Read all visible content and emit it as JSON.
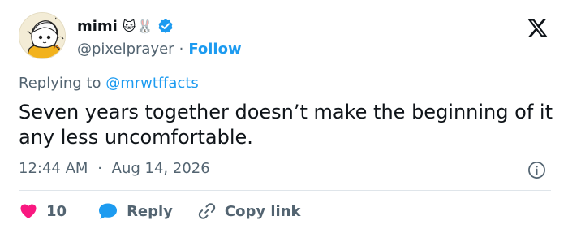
{
  "author": {
    "display_name": "mimi",
    "name_suffix": "🐱🐰",
    "handle": "@pixelprayer",
    "follow_label": "Follow",
    "separator": "·",
    "verified_color": "#1d9bf0"
  },
  "reply_context": {
    "prefix": "Replying to",
    "mention": "@mrwtffacts"
  },
  "tweet": {
    "text": "Seven years together doesn’t make the beginning of it any less uncomfortable.",
    "time": "12:44 AM",
    "date": "Aug 14, 2026",
    "separator": "·"
  },
  "actions": {
    "like_count": "10",
    "reply_label": "Reply",
    "copy_label": "Copy link"
  },
  "icons": {
    "logo": "x-logo-icon",
    "verified": "verified-badge-icon",
    "info": "info-icon",
    "like": "heart-icon",
    "reply": "speech-bubble-icon",
    "copy": "link-icon"
  },
  "colors": {
    "accent": "#1d9bf0",
    "like": "#f91880",
    "text": "#0f1419",
    "muted": "#536471"
  }
}
